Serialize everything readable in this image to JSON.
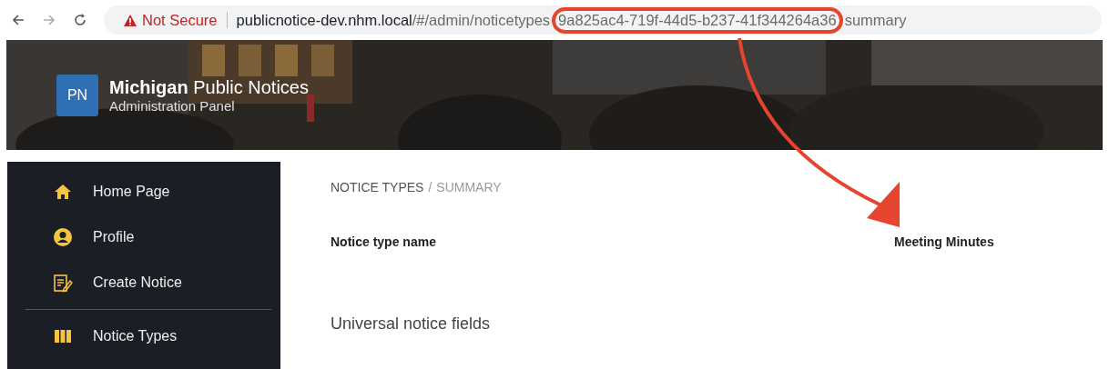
{
  "browser": {
    "security_label": "Not Secure",
    "url_host": "publicnotice-dev.nhm.local",
    "url_path": "/#/admin/noticetypes",
    "url_id": "9a825ac4-719f-44d5-b237-41f344264a36",
    "url_tail": "summary"
  },
  "header": {
    "logo_text": "PN",
    "title_bold": "Michigan",
    "title_rest": "Public Notices",
    "subtitle": "Administration Panel"
  },
  "sidebar": {
    "items": [
      {
        "label": "Home Page",
        "kind": "home"
      },
      {
        "label": "Profile",
        "kind": "user"
      },
      {
        "label": "Create Notice",
        "kind": "notepad"
      },
      {
        "label": "Notice Types",
        "kind": "grid"
      }
    ]
  },
  "breadcrumb": {
    "items": [
      "NOTICE TYPES",
      "SUMMARY"
    ],
    "separator": "/"
  },
  "fields": [
    {
      "label": "Notice type name",
      "value": "Meeting Minutes"
    }
  ],
  "section_title": "Universal notice fields"
}
